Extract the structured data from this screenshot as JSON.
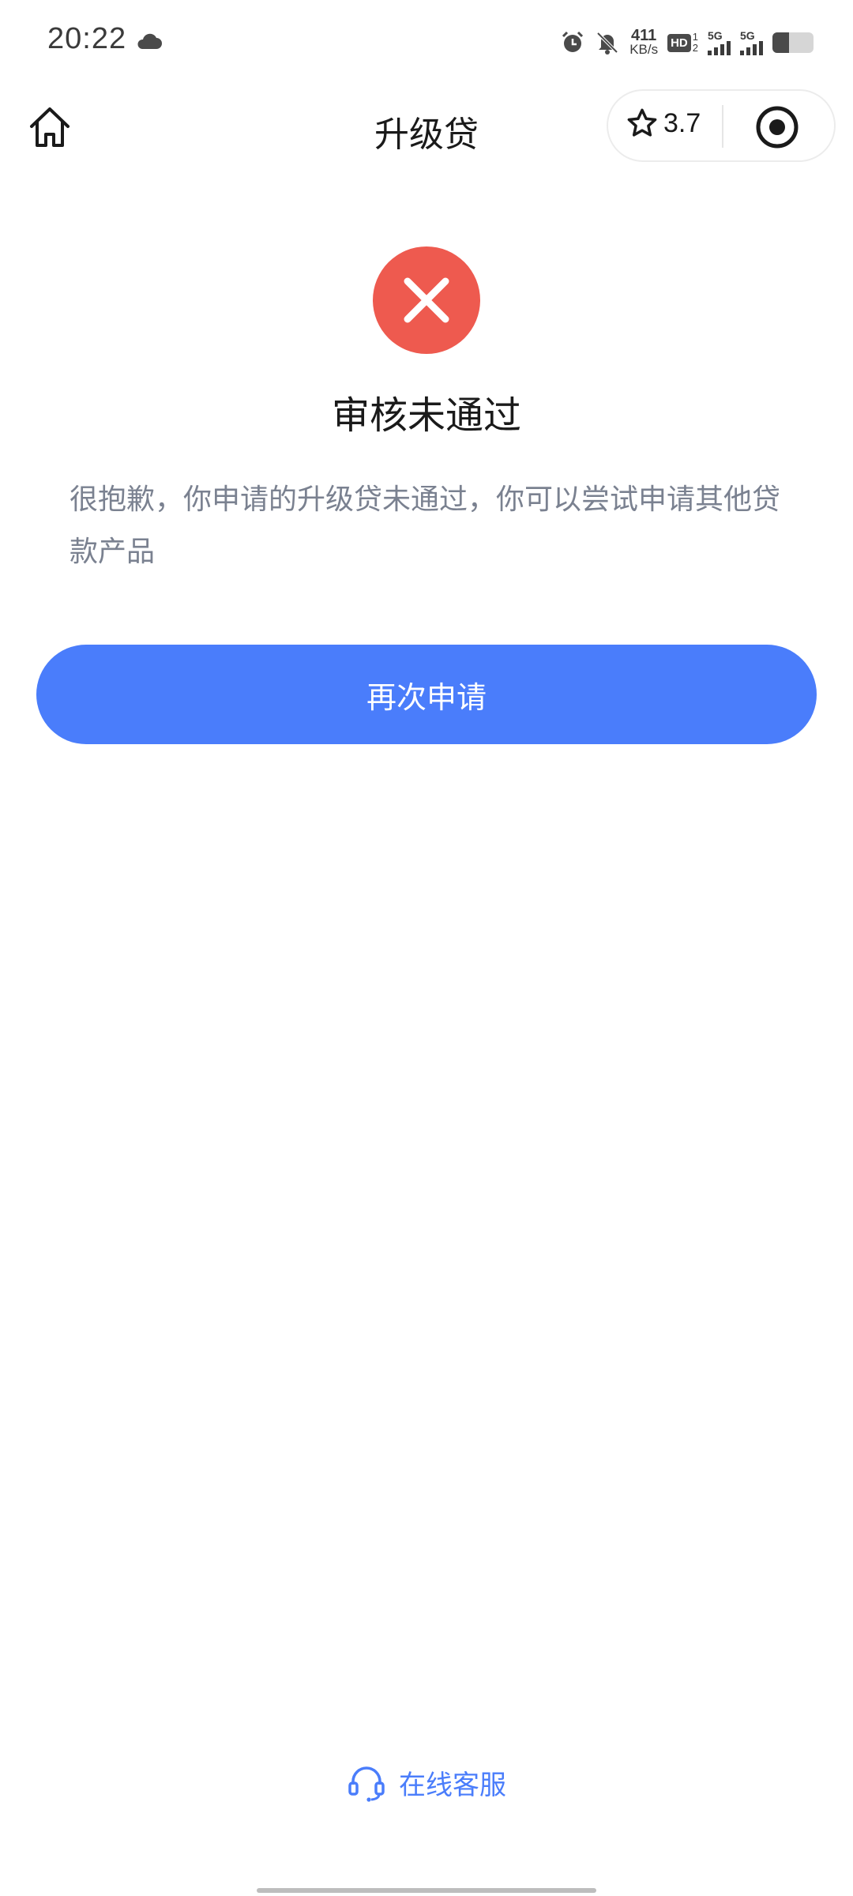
{
  "status_bar": {
    "time": "20:22",
    "net_speed_value": "411",
    "net_speed_unit": "KB/s",
    "hd_label": "HD",
    "hd_sub_top": "1",
    "hd_sub_bottom": "2",
    "sim1_label": "5G",
    "sim2_label": "5G",
    "battery_level": 0.4,
    "icons": [
      "cloud-icon",
      "alarm-icon",
      "mute-icon",
      "signal-icon",
      "battery-icon"
    ]
  },
  "nav": {
    "title": "升级贷",
    "rating": "3.7",
    "icons": [
      "home-icon",
      "star-icon",
      "target-icon"
    ]
  },
  "result": {
    "status": "rejected",
    "status_color": "#ee5a4f",
    "title": "审核未通过",
    "description": "很抱歉，你申请的升级贷未通过，你可以尝试申请其他贷款产品"
  },
  "actions": {
    "reapply_label": "再次申请",
    "accent_color": "#4a7dfb"
  },
  "footer": {
    "service_label": "在线客服",
    "service_icon": "headset-icon"
  }
}
